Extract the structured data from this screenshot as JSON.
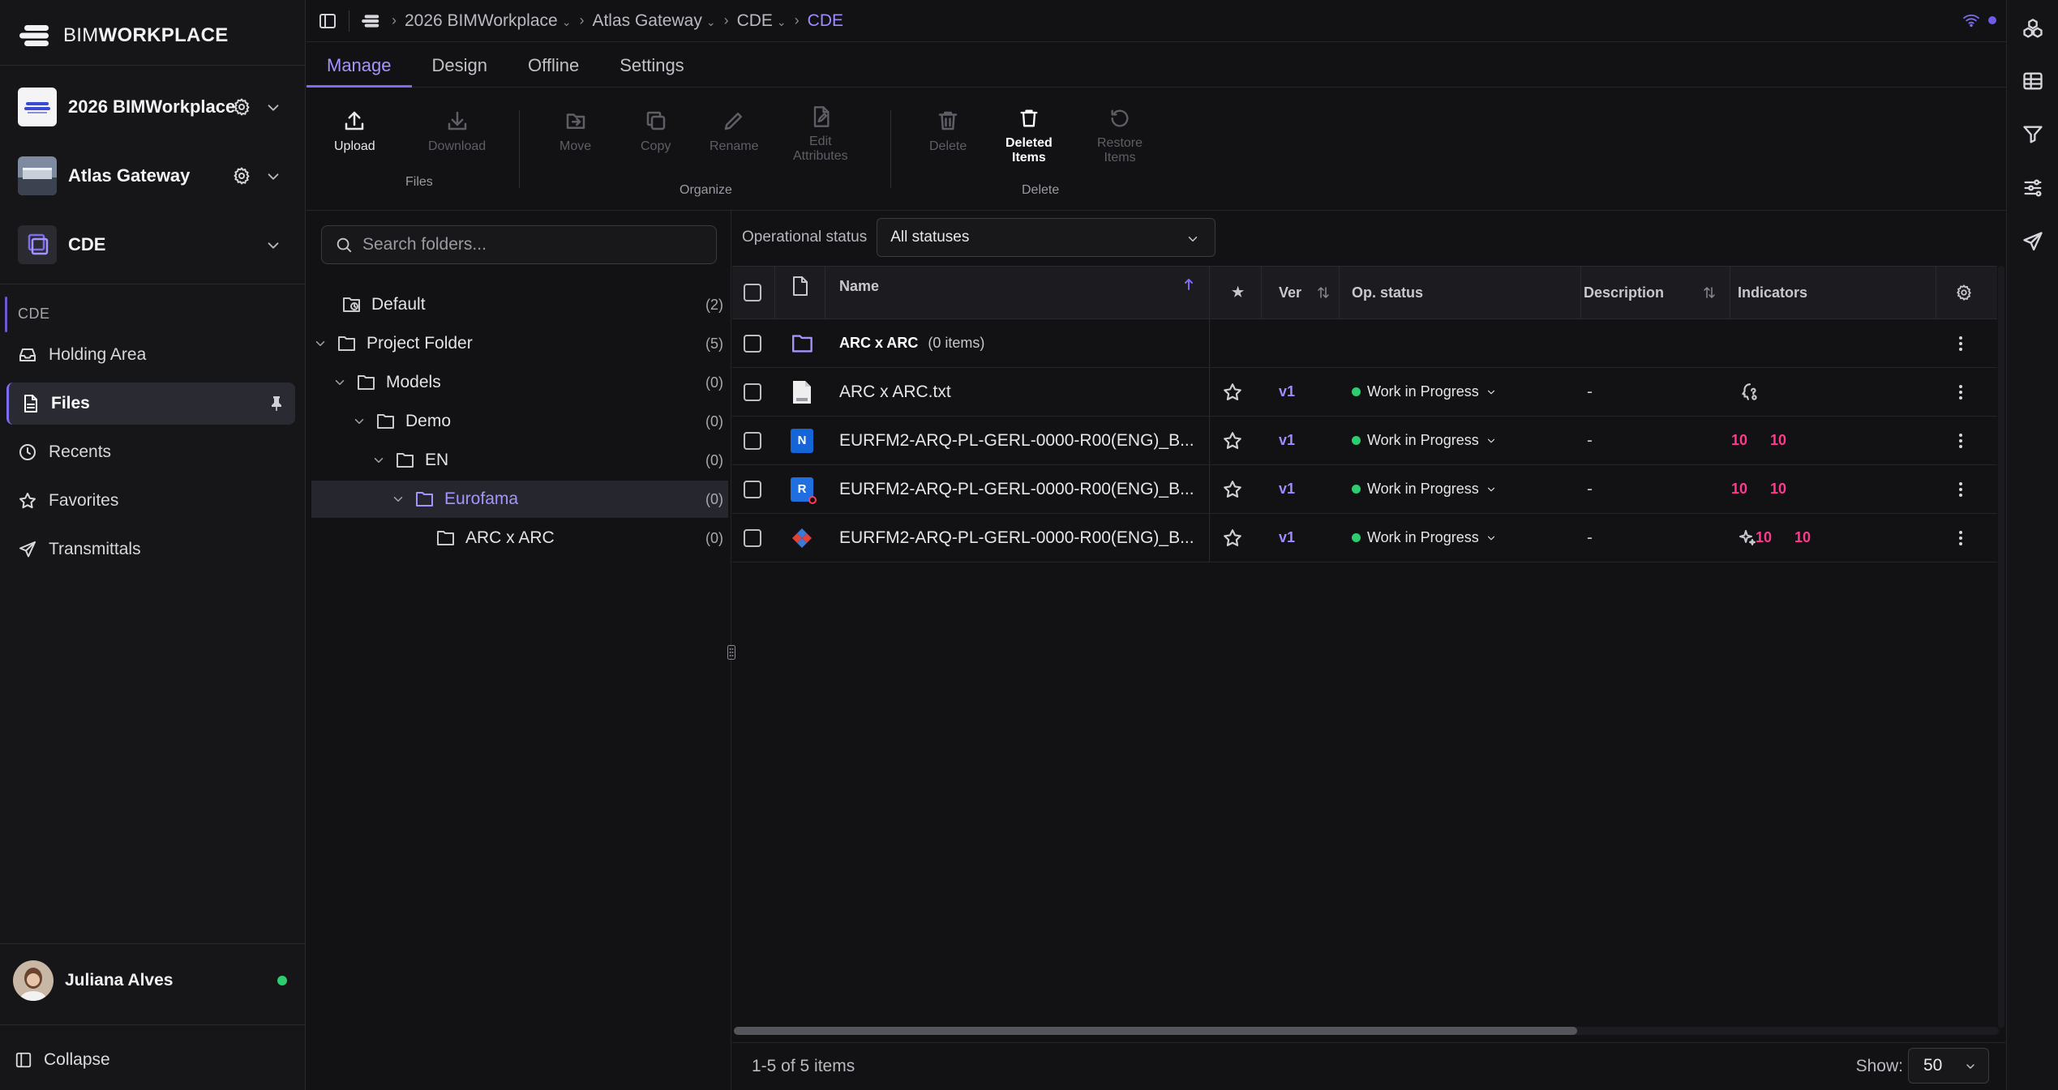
{
  "brand": {
    "prefix": "BIM",
    "suffix": "WORKPLACE"
  },
  "projects": [
    {
      "name": "2026 BIMWorkplace"
    },
    {
      "name": "Atlas Gateway"
    },
    {
      "name": "CDE"
    }
  ],
  "nav": {
    "section_label": "CDE",
    "items": [
      {
        "label": "Holding Area"
      },
      {
        "label": "Files"
      },
      {
        "label": "Recents"
      },
      {
        "label": "Favorites"
      },
      {
        "label": "Transmittals"
      }
    ]
  },
  "user": {
    "name": "Juliana Alves"
  },
  "collapse_label": "Collapse",
  "breadcrumb": {
    "items": [
      "2026 BIMWorkplace",
      "Atlas Gateway",
      "CDE"
    ],
    "current": "CDE"
  },
  "tabs": [
    "Manage",
    "Design",
    "Offline",
    "Settings"
  ],
  "ribbon": {
    "upload": "Upload",
    "download": "Download",
    "group_files": "Files",
    "move": "Move",
    "copy": "Copy",
    "rename": "Rename",
    "edit_attributes_1": "Edit",
    "edit_attributes_2": "Attributes",
    "group_organize": "Organize",
    "delete": "Delete",
    "deleted_items_1": "Deleted",
    "deleted_items_2": "Items",
    "restore_items_1": "Restore",
    "restore_items_2": "Items",
    "group_delete": "Delete"
  },
  "folder_search": {
    "placeholder": "Search folders..."
  },
  "folder_tree": [
    {
      "name": "Default",
      "count": "(2)"
    },
    {
      "name": "Project Folder",
      "count": "(5)"
    },
    {
      "name": "Models",
      "count": "(0)"
    },
    {
      "name": "Demo",
      "count": "(0)"
    },
    {
      "name": "EN",
      "count": "(0)"
    },
    {
      "name": "Eurofama",
      "count": "(0)"
    },
    {
      "name": "ARC x ARC",
      "count": "(0)"
    }
  ],
  "filter": {
    "label": "Operational status",
    "value": "All statuses"
  },
  "columns": {
    "name": "Name",
    "favorite": "★",
    "version": "Ver",
    "op_status": "Op. status",
    "description": "Description",
    "indicators": "Indicators"
  },
  "rows": [
    {
      "name": "ARC x ARC",
      "count": "(0 items)"
    },
    {
      "name": "ARC x ARC.txt",
      "version": "v1",
      "status": "Work in Progress",
      "description": "-"
    },
    {
      "name": "EURFM2-ARQ-PL-GERL-0000-R00(ENG)_B...",
      "version": "v1",
      "status": "Work in Progress",
      "description": "-",
      "ind_a": "10",
      "ind_b": "10"
    },
    {
      "name": "EURFM2-ARQ-PL-GERL-0000-R00(ENG)_B...",
      "version": "v1",
      "status": "Work in Progress",
      "description": "-",
      "ind_a": "10",
      "ind_b": "10"
    },
    {
      "name": "EURFM2-ARQ-PL-GERL-0000-R00(ENG)_B...",
      "version": "v1",
      "status": "Work in Progress",
      "description": "-",
      "ind_a": "10",
      "ind_b": "10"
    }
  ],
  "footer": {
    "range": "1-5 of 5 items",
    "show_label": "Show:",
    "page_size": "50"
  },
  "colors": {
    "accent": "#7b6cf0",
    "indicator": "#ff3a8c",
    "status_ok": "#2ecc71"
  }
}
